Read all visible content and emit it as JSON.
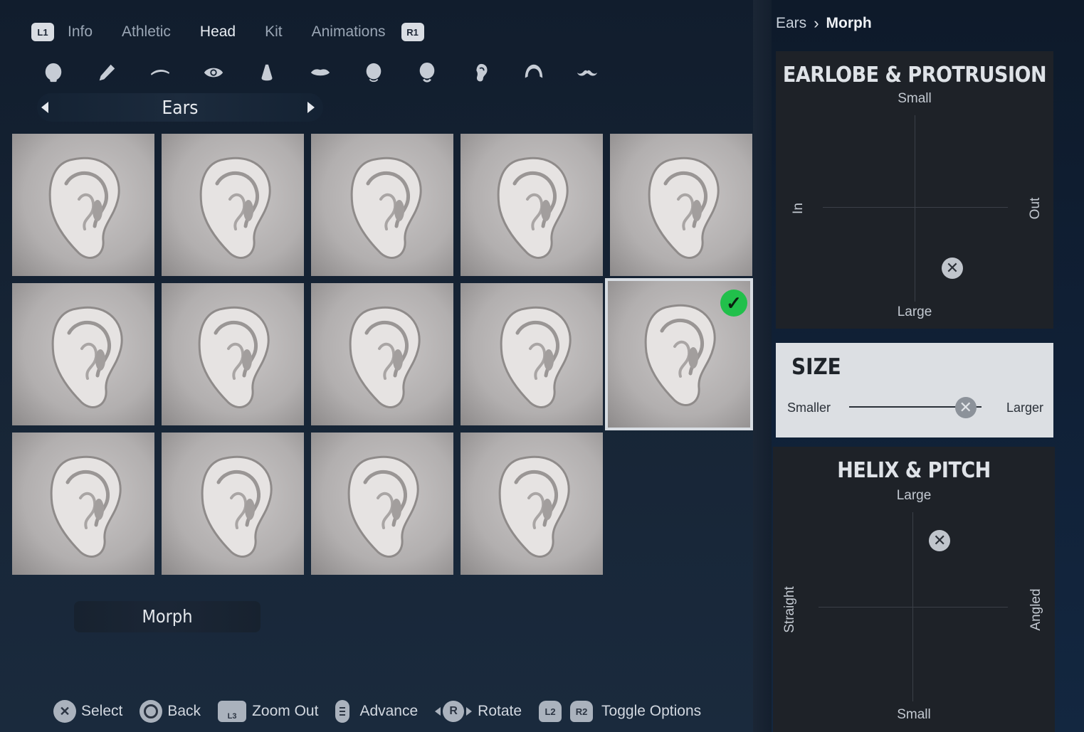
{
  "tabs": {
    "left_shoulder": "L1",
    "right_shoulder": "R1",
    "items": [
      {
        "label": "Info"
      },
      {
        "label": "Athletic"
      },
      {
        "label": "Head",
        "active": true
      },
      {
        "label": "Kit"
      },
      {
        "label": "Animations"
      }
    ]
  },
  "feature_icons": [
    "head-shape-icon",
    "eyebrow-pencil-icon",
    "eyebrow-icon",
    "eye-icon",
    "nose-icon",
    "mouth-icon",
    "jaw-icon",
    "chin-icon",
    "ear-icon",
    "hair-icon",
    "mustache-icon"
  ],
  "category": {
    "label": "Ears"
  },
  "ear_grid": {
    "count": 14,
    "selected_index": 9
  },
  "morph_button": "Morph",
  "hints": {
    "select": "Select",
    "back": "Back",
    "l3": "L3",
    "zoom_out": "Zoom Out",
    "advance": "Advance",
    "r": "R",
    "rotate": "Rotate",
    "l2": "L2",
    "r2": "R2",
    "toggle_options": "Toggle Options"
  },
  "breadcrumb": {
    "parent": "Ears",
    "current": "Morph"
  },
  "earlobe": {
    "title": "EARLOBE & PROTRUSION",
    "top": "Small",
    "bottom": "Large",
    "left": "In",
    "right": "Out",
    "value_x": 0.7,
    "value_y": 0.82
  },
  "size": {
    "title": "SIZE",
    "min_label": "Smaller",
    "max_label": "Larger",
    "value": 0.88
  },
  "helix": {
    "title": "HELIX & PITCH",
    "top": "Large",
    "bottom": "Small",
    "left": "Straight",
    "right": "Angled",
    "value_x": 0.64,
    "value_y": 0.15
  },
  "colors": {
    "selected_check": "#21c04b",
    "panel": "#1e2228"
  }
}
